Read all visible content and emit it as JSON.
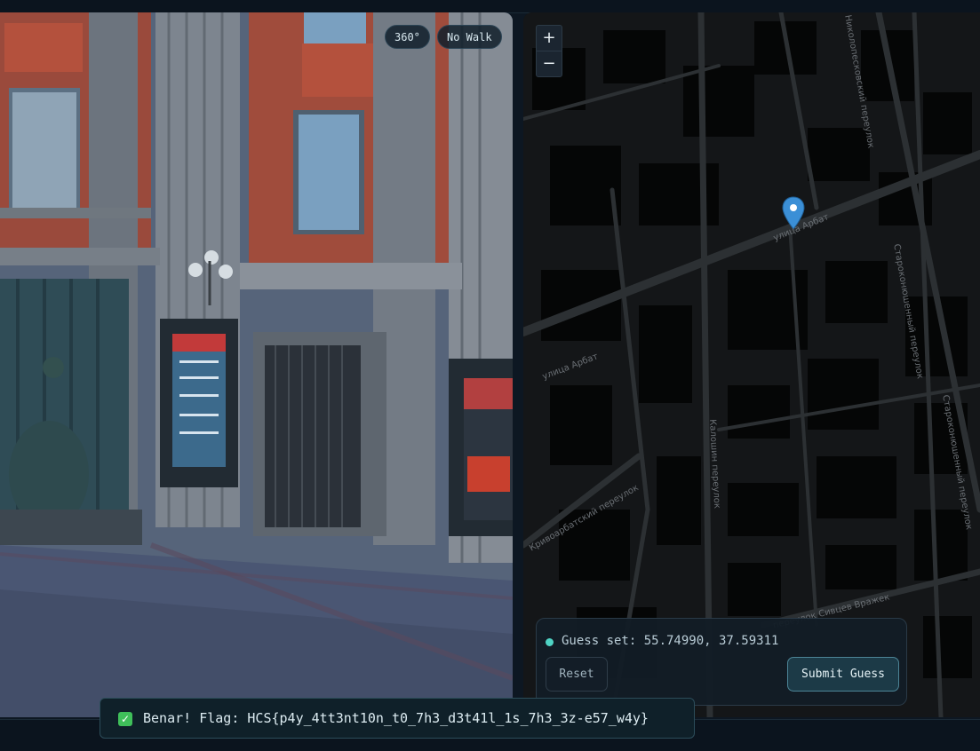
{
  "street_view": {
    "btn_360": "360°",
    "btn_nowalk": "No Walk"
  },
  "map": {
    "zoom_in": "+",
    "zoom_out": "−",
    "streets": {
      "arbat_lane": "улица Арбат",
      "arbat_street": "улица Арбат",
      "kaloshin": "Калошин переулок",
      "krivoarbatsky": "Кривоарбатский переулок",
      "sivtsev": "переулок Сивцев Вражек",
      "starokonyushenny": "Староконюшенный переулок",
      "starokonyushenny2": "Староконюшенный переулок",
      "nikolopeskovsky": "Николопесковский переулок"
    },
    "marker_color": "#3b8fd6"
  },
  "guess_panel": {
    "status": "Guess set: 55.74990, 37.59311",
    "reset_label": "Reset",
    "submit_label": "Submit Guess"
  },
  "toast": {
    "icon": "check-icon",
    "message": "Benar! Flag: HCS{p4y_4tt3nt10n_t0_7h3_d3t41l_1s_7h3_3z-e57_w4y}"
  }
}
